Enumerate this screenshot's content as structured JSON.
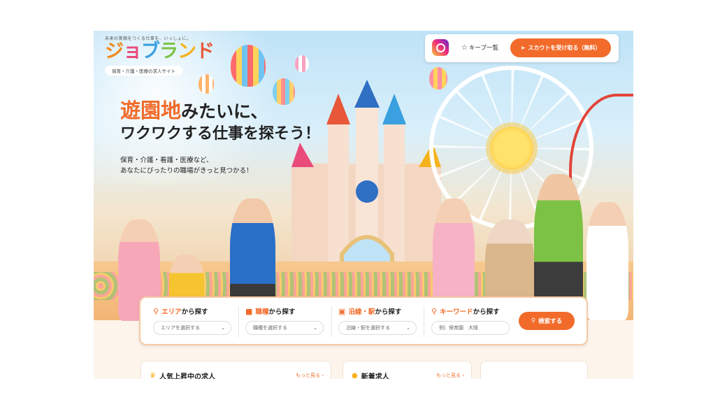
{
  "header": {
    "tagline": "未来の笑顔をつくる仕事を、いっしょに。",
    "logo_chars": [
      "ジ",
      "ョ",
      "ブ",
      "ラ",
      "ン",
      "ド"
    ],
    "subtitle": "保育・介護・医療の求人サイト"
  },
  "topbar": {
    "instagram_icon": "instagram-icon",
    "keep_label": "キープ一覧",
    "scout_label": "スカウトを受け取る（無料）"
  },
  "hero": {
    "headline_accent": "遊園地",
    "headline_rest": "みたいに、",
    "headline_line2": "ワクワクする仕事を探そう！",
    "desc_line1": "保育・介護・看護・医療など、",
    "desc_line2": "あなたにぴったりの職場がきっと見つかる！"
  },
  "search": {
    "area": {
      "label_hl": "エリア",
      "label_rest": "から探す",
      "placeholder": "エリアを選択する"
    },
    "job": {
      "label_hl": "職種",
      "label_rest": "から探す",
      "placeholder": "職種を選択する"
    },
    "station": {
      "label_hl": "沿線・駅",
      "label_rest": "から探す",
      "placeholder": "沿線・駅を選択する"
    },
    "keyword": {
      "label_hl": "キーワード",
      "label_rest": "から探す",
      "placeholder": "例）保育園　大阪"
    },
    "button_label": "検索する"
  },
  "sections": [
    {
      "title": "人気上昇中の求人",
      "more": "もっと見る ›"
    },
    {
      "title": "新着求人",
      "more": "もっと見る ›"
    }
  ],
  "colors": {
    "accent": "#f26b2a",
    "card_border": "#f5c9a4"
  }
}
